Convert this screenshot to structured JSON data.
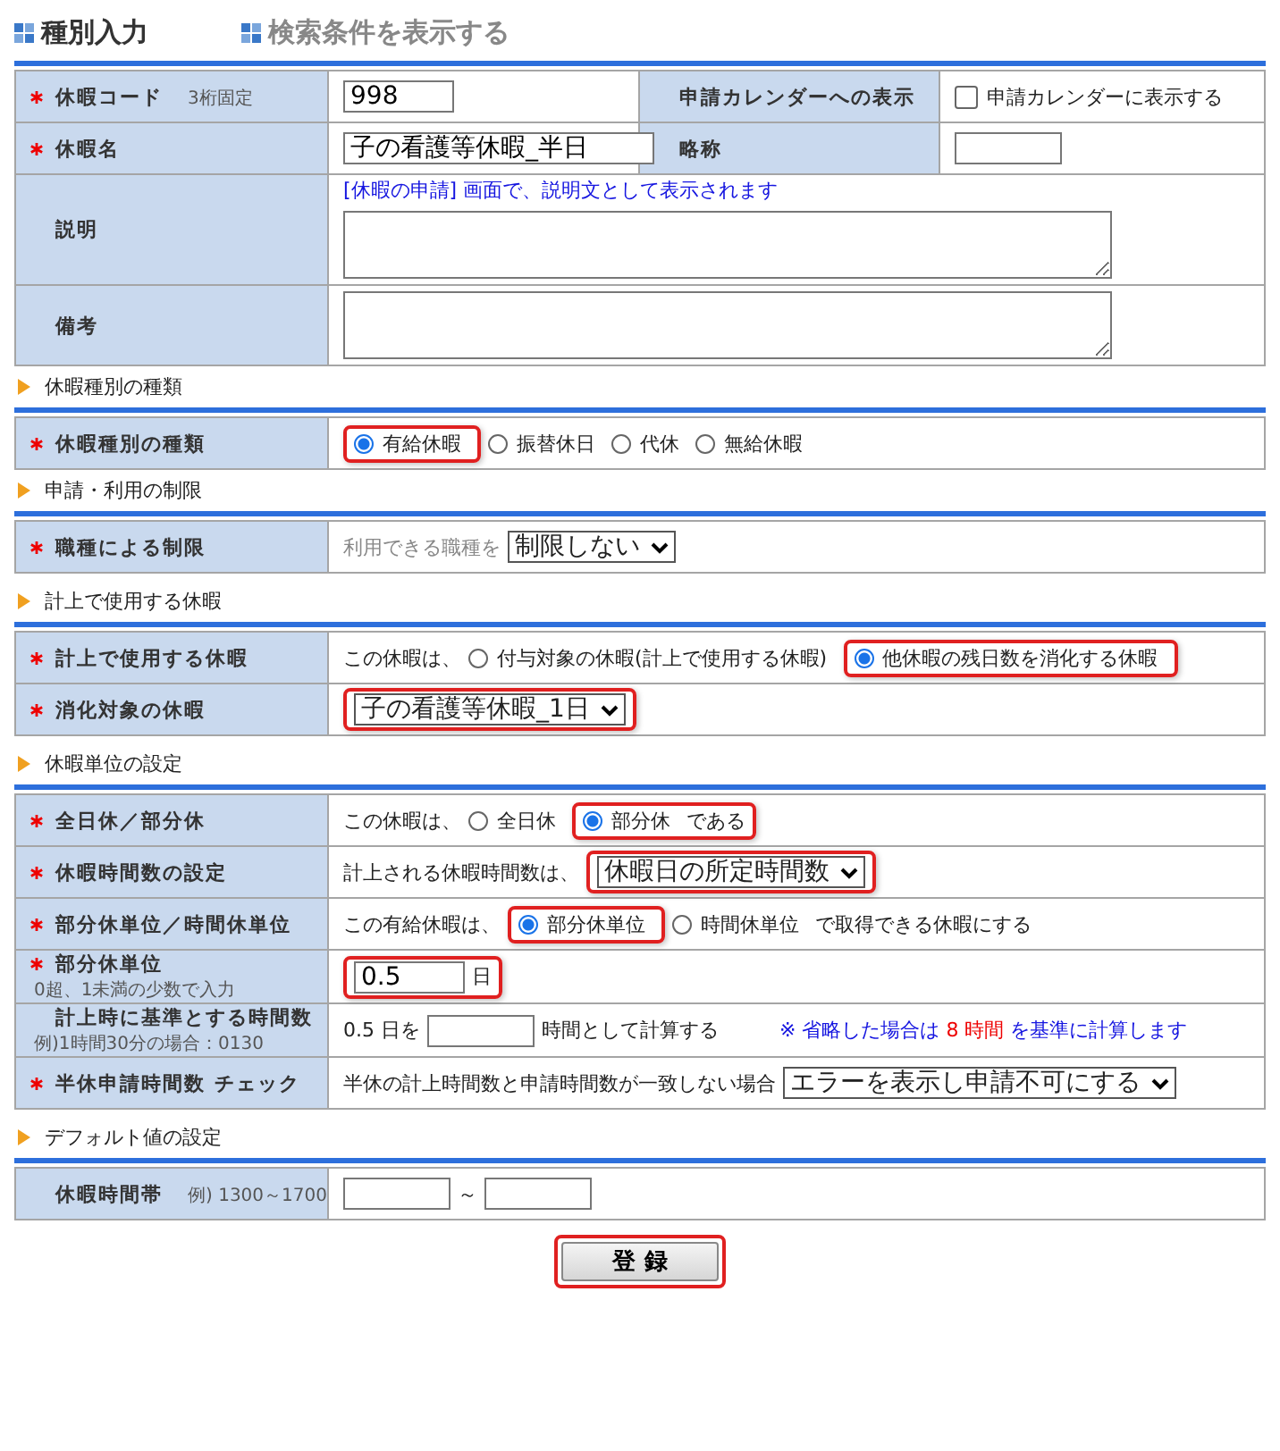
{
  "tabs": [
    {
      "label": "種別入力",
      "selected": true
    },
    {
      "label": "検索条件を表示する",
      "selected": false
    }
  ],
  "sections": [
    {
      "rows": [
        {
          "fields": [
            {
              "label": "休暇コード",
              "required": true,
              "note": "3桁固定",
              "content": [
                {
                  "kind": "input",
                  "value": "998"
                }
              ]
            },
            {
              "label": "申請カレンダーへの表示",
              "required": false,
              "content": [
                {
                  "kind": "checkbox",
                  "label": "申請カレンダーに表示する",
                  "checked": false
                }
              ]
            }
          ]
        },
        {
          "fields": [
            {
              "label": "休暇名",
              "required": true,
              "content": [
                {
                  "kind": "input",
                  "value": "子の看護等休暇_半日"
                }
              ]
            },
            {
              "label": "略称",
              "required": false,
              "content": [
                {
                  "kind": "input"
                }
              ]
            }
          ]
        },
        {
          "fields": [
            {
              "label": "説明",
              "required": false,
              "content": [
                {
                  "kind": "hint",
                  "text": "[休暇の申請] 画面で、説明文として表示されます"
                },
                {
                  "kind": "textarea"
                }
              ]
            }
          ]
        },
        {
          "fields": [
            {
              "label": "備考",
              "required": false,
              "content": [
                {
                  "kind": "textarea"
                }
              ]
            }
          ]
        }
      ]
    },
    {
      "heading": "休暇種別の種類",
      "rows": [
        {
          "fields": [
            {
              "label": "休暇種別の種類",
              "required": true,
              "content": [
                {
                  "kind": "group",
                  "highlighted": true,
                  "parts": [
                    {
                      "kind": "radio",
                      "label": "有給休暇",
                      "selected": true
                    }
                  ]
                },
                {
                  "kind": "radio",
                  "label": "振替休日",
                  "selected": false
                },
                {
                  "kind": "radio",
                  "label": "代休",
                  "selected": false
                },
                {
                  "kind": "radio",
                  "label": "無給休暇",
                  "selected": false
                }
              ]
            }
          ]
        }
      ]
    },
    {
      "heading": "申請・利用の制限",
      "rows": [
        {
          "fields": [
            {
              "label": "職種による制限",
              "required": true,
              "content": [
                {
                  "kind": "text",
                  "text": "利用できる職種を",
                  "muted": true
                },
                {
                  "kind": "select",
                  "value": "制限しない"
                }
              ]
            }
          ]
        }
      ]
    },
    {
      "heading": "計上で使用する休暇",
      "rows": [
        {
          "fields": [
            {
              "label": "計上で使用する休暇",
              "required": true,
              "content": [
                {
                  "kind": "text",
                  "text": "この休暇は、",
                  "muted": false
                },
                {
                  "kind": "radio",
                  "label": "付与対象の休暇(計上で使用する休暇)",
                  "selected": false
                },
                {
                  "kind": "group",
                  "highlighted": true,
                  "parts": [
                    {
                      "kind": "radio",
                      "label": "他休暇の残日数を消化する休暇",
                      "selected": true
                    }
                  ]
                }
              ]
            }
          ]
        },
        {
          "fields": [
            {
              "label": "消化対象の休暇",
              "required": true,
              "content": [
                {
                  "kind": "group",
                  "highlighted": true,
                  "parts": [
                    {
                      "kind": "select",
                      "value": "子の看護等休暇_1日"
                    }
                  ]
                }
              ]
            }
          ]
        }
      ]
    },
    {
      "heading": "休暇単位の設定",
      "rows": [
        {
          "fields": [
            {
              "label": "全日休／部分休",
              "required": true,
              "content": [
                {
                  "kind": "text",
                  "text": "この休暇は、",
                  "muted": false
                },
                {
                  "kind": "radio",
                  "label": "全日休",
                  "selected": false
                },
                {
                  "kind": "group",
                  "highlighted": true,
                  "parts": [
                    {
                      "kind": "radio",
                      "label": "部分休",
                      "selected": true
                    },
                    {
                      "kind": "text",
                      "text": "である",
                      "muted": false
                    }
                  ]
                }
              ]
            }
          ]
        },
        {
          "fields": [
            {
              "label": "休暇時間数の設定",
              "required": true,
              "content": [
                {
                  "kind": "text",
                  "text": "計上される休暇時間数は、",
                  "muted": false
                },
                {
                  "kind": "group",
                  "highlighted": true,
                  "parts": [
                    {
                      "kind": "select",
                      "value": "休暇日の所定時間数"
                    }
                  ]
                }
              ]
            }
          ]
        },
        {
          "fields": [
            {
              "label": "部分休単位／時間休単位",
              "required": true,
              "content": [
                {
                  "kind": "text",
                  "text": "この有給休暇は、",
                  "muted": false
                },
                {
                  "kind": "group",
                  "highlighted": true,
                  "parts": [
                    {
                      "kind": "radio",
                      "label": "部分休単位",
                      "selected": true
                    }
                  ]
                },
                {
                  "kind": "radio",
                  "label": "時間休単位",
                  "selected": false
                },
                {
                  "kind": "text",
                  "text": "で取得できる休暇にする",
                  "muted": false
                }
              ]
            }
          ]
        },
        {
          "fields": [
            {
              "label": "部分休単位",
              "required": true,
              "subnote": "0超、1未満の少数で入力",
              "content": [
                {
                  "kind": "group",
                  "highlighted": true,
                  "parts": [
                    {
                      "kind": "input",
                      "value": "0.5"
                    },
                    {
                      "kind": "text",
                      "text": "日",
                      "muted": false
                    }
                  ]
                }
              ]
            }
          ]
        },
        {
          "fields": [
            {
              "label": "計上時に基準とする時間数",
              "required": false,
              "subnote": "例)1時間30分の場合：0130",
              "content": [
                {
                  "kind": "text",
                  "text": "0.5 日を",
                  "muted": false
                },
                {
                  "kind": "input"
                },
                {
                  "kind": "text",
                  "text": "時間として計算する",
                  "muted": false
                },
                {
                  "kind": "notice",
                  "parts": [
                    {
                      "text": "※ 省略した場合は",
                      "alert": false
                    },
                    {
                      "text": "8 時間",
                      "alert": true
                    },
                    {
                      "text": "を基準に計算します",
                      "alert": false
                    }
                  ]
                }
              ]
            }
          ]
        },
        {
          "fields": [
            {
              "label": "半休申請時間数 チェック",
              "required": true,
              "content": [
                {
                  "kind": "text",
                  "text": "半休の計上時間数と申請時間数が一致しない場合",
                  "muted": false
                },
                {
                  "kind": "select",
                  "value": "エラーを表示し申請不可にする"
                }
              ]
            }
          ]
        }
      ]
    },
    {
      "heading": "デフォルト値の設定",
      "rows": [
        {
          "fields": [
            {
              "label": "休暇時間帯",
              "required": false,
              "note": "例) 1300～1700",
              "content": [
                {
                  "kind": "input"
                },
                {
                  "kind": "text",
                  "text": "～",
                  "muted": false
                },
                {
                  "kind": "input"
                }
              ]
            }
          ]
        }
      ]
    }
  ],
  "submit": {
    "label": "登 録",
    "highlighted": true
  }
}
